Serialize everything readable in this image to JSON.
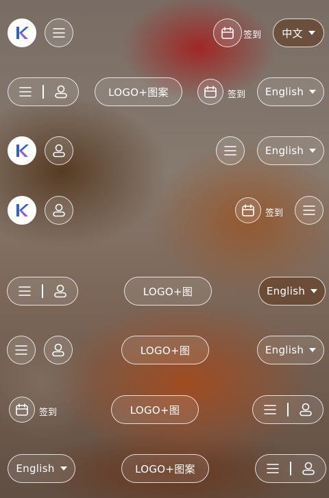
{
  "labels": {
    "sign_in": "签到",
    "lang_zh": "中文",
    "lang_en": "English",
    "logo_full": "LOGO+图案",
    "logo_short": "LOGO+图"
  },
  "icons": {
    "brand": "brand-logo-icon",
    "menu": "menu-icon",
    "user": "user-icon",
    "calendar": "calendar-icon",
    "dropdown": "caret-down-icon"
  },
  "colors": {
    "brand_blue": "#2f5fd0",
    "brand_purple": "#8e5fe0",
    "outline": "#ffffff"
  }
}
